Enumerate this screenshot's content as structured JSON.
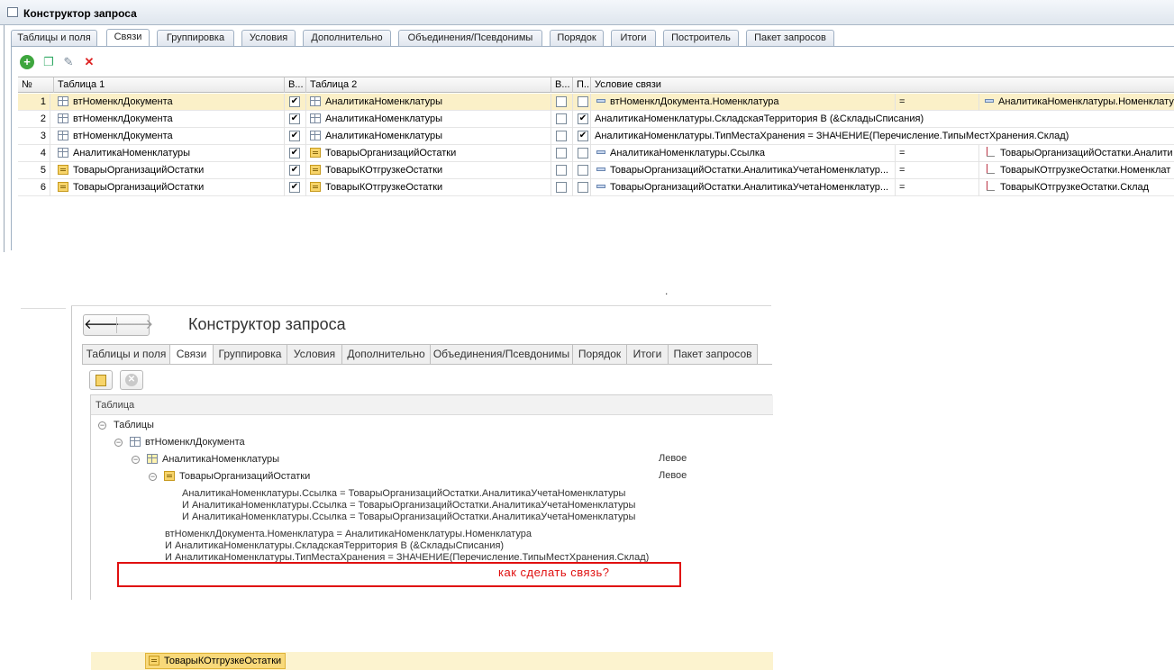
{
  "win1": {
    "title": "Конструктор запроса",
    "tabs": [
      "Таблицы и поля",
      "Связи",
      "Группировка",
      "Условия",
      "Дополнительно",
      "Объединения/Псевдонимы",
      "Порядок",
      "Итоги",
      "Построитель",
      "Пакет запросов"
    ],
    "active_tab": "Связи",
    "toolbar_icons": [
      "add-icon",
      "copy-icon",
      "edit-icon",
      "delete-icon"
    ],
    "columns": [
      "№",
      "Таблица 1",
      "В...",
      "Таблица 2",
      "В...",
      "П...",
      "Условие связи"
    ],
    "rows": [
      {
        "n": "1",
        "t1": "втНоменклДокумента",
        "t1icon": "table-icon",
        "all1": true,
        "t2": "АналитикаНоменклатуры",
        "t2icon": "table-icon",
        "all2": false,
        "cust": false,
        "cond_left": "втНоменклДокумента.Номенклатура",
        "op": "=",
        "cond_right": "АналитикаНоменклатуры.Номенклатура",
        "simple": true
      },
      {
        "n": "2",
        "t1": "втНоменклДокумента",
        "t1icon": "table-icon",
        "all1": true,
        "t2": "АналитикаНоменклатуры",
        "t2icon": "table-icon",
        "all2": false,
        "cust": true,
        "cond_text": "АналитикаНоменклатуры.СкладскаяТерритория В (&СкладыСписания)",
        "simple": false
      },
      {
        "n": "3",
        "t1": "втНоменклДокумента",
        "t1icon": "table-icon",
        "all1": true,
        "t2": "АналитикаНоменклатуры",
        "t2icon": "table-icon",
        "all2": false,
        "cust": true,
        "cond_text": "АналитикаНоменклатуры.ТипМестаХранения = ЗНАЧЕНИЕ(Перечисление.ТипыМестХранения.Склад)",
        "simple": false
      },
      {
        "n": "4",
        "t1": "АналитикаНоменклатуры",
        "t1icon": "table-icon",
        "all1": true,
        "t2": "ТоварыОрганизацийОстатки",
        "t2icon": "register-icon",
        "all2": false,
        "cust": false,
        "cond_left": "АналитикаНоменклатуры.Ссылка",
        "op": "=",
        "cond_right": "ТоварыОрганизацийОстатки.Аналити",
        "simple": true
      },
      {
        "n": "5",
        "t1": "ТоварыОрганизацийОстатки",
        "t1icon": "register-icon",
        "all1": true,
        "t2": "ТоварыКОтгрузкеОстатки",
        "t2icon": "register-icon",
        "all2": false,
        "cust": false,
        "cond_left": "ТоварыОрганизацийОстатки.АналитикаУчетаНоменклатур...",
        "op": "=",
        "cond_right": "ТоварыКОтгрузкеОстатки.Номенклат",
        "simple": true
      },
      {
        "n": "6",
        "t1": "ТоварыОрганизацийОстатки",
        "t1icon": "register-icon",
        "all1": true,
        "t2": "ТоварыКОтгрузкеОстатки",
        "t2icon": "register-icon",
        "all2": false,
        "cust": false,
        "cond_left": "ТоварыОрганизацийОстатки.АналитикаУчетаНоменклатур...",
        "op": "=",
        "cond_right": "ТоварыКОтгрузкеОстатки.Склад",
        "simple": true
      }
    ]
  },
  "separator": ".",
  "win2": {
    "title": "Конструктор запроса",
    "nav_back": "🡐",
    "nav_forward": "🡒",
    "tabs": [
      "Таблицы и поля",
      "Связи",
      "Группировка",
      "Условия",
      "Дополнительно",
      "Объединения/Псевдонимы",
      "Порядок",
      "Итоги",
      "Пакет запросов"
    ],
    "active_tab": "Связи",
    "tree_header": "Таблица",
    "tree": {
      "root": "Таблицы",
      "n1": "втНоменклДокумента",
      "n2": "АналитикаНоменклатуры",
      "n2_join": "Левое",
      "n3": "ТоварыОрганизацийОстатки",
      "n3_join": "Левое",
      "n3_cond": [
        "АналитикаНоменклатуры.Ссылка = ТоварыОрганизацийОстатки.АналитикаУчетаНоменклатуры",
        "И АналитикаНоменклатуры.Ссылка = ТоварыОрганизацийОстатки.АналитикаУчетаНоменклатуры",
        "И АналитикаНоменклатуры.Ссылка = ТоварыОрганизацийОстатки.АналитикаУчетаНоменклатуры"
      ],
      "n2_cond": [
        "втНоменклДокумента.Номенклатура = АналитикаНоменклатуры.Номенклатура",
        "И АналитикаНоменклатуры.СкладскаяТерритория В (&СкладыСписания)",
        "И АналитикаНоменклатуры.ТипМестаХранения = ЗНАЧЕНИЕ(Перечисление.ТипыМестХранения.Склад)"
      ],
      "selected": "ТоварыКОтгрузкеОстатки"
    },
    "annotation": "как сделать связь?",
    "annotation_color": "#e01010"
  }
}
